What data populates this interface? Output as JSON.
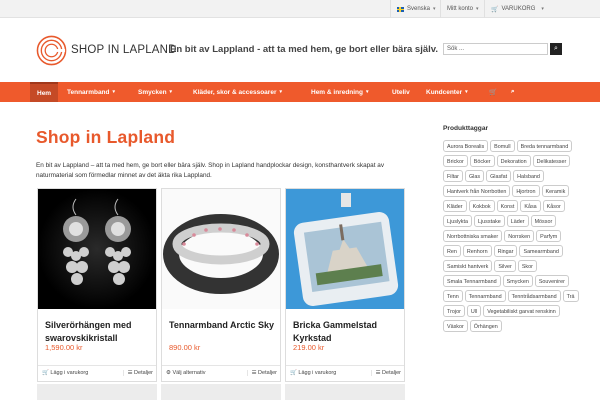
{
  "topbar": {
    "language": "Svenska",
    "account": "Mitt konto",
    "cart": "VARUKORG"
  },
  "header": {
    "brand": "SHOP IN LAPLAND",
    "tagline": "En bit av Lappland - att ta med hem, ge bort eller bära själv.",
    "search_placeholder": "Sök ..."
  },
  "nav": {
    "items": [
      "Hem",
      "Tennarmband",
      "Smycken",
      "Kläder, skor & accessoarer",
      "Hem & inredning",
      "Uteliv",
      "Kundcenter"
    ]
  },
  "main": {
    "title": "Shop in Lapland",
    "intro": "En bit av Lappland – att ta med hem, ge bort eller bära själv. Shop in Lapland handplockar design, konsthantverk skapat av naturmaterial som förmedlar minnet av det äkta rika Lappland."
  },
  "products": [
    {
      "name": "Silverörhängen med swarovskikristall",
      "price": "1,590.00 kr",
      "action": "Lägg i varukorg",
      "details": "Detaljer"
    },
    {
      "name": "Tennarmband Arctic Sky",
      "price": "890.00 kr",
      "action": "Välj alternativ",
      "details": "Detaljer"
    },
    {
      "name": "Bricka Gammelstad Kyrkstad",
      "price": "219.00 kr",
      "action": "Lägg i varukorg",
      "details": "Detaljer"
    }
  ],
  "sidebar": {
    "title": "Produkttaggar",
    "tags": [
      "Aurora Borealis",
      "Bomull",
      "Breda tennarmband",
      "Brickor",
      "Böcker",
      "Dekoration",
      "Delikatesser",
      "Filtar",
      "Glas",
      "Glasfat",
      "Halsband",
      "Hantverk från Norrbotten",
      "Hjortron",
      "Keramik",
      "Kläder",
      "Kokbok",
      "Konst",
      "Kåsa",
      "Kåsor",
      "Ljuslykta",
      "Ljusstake",
      "Läder",
      "Mössor",
      "Norrbottniska smaker",
      "Norrsken",
      "Parfym",
      "Ren",
      "Renhorn",
      "Ringar",
      "Samearmband",
      "Samiskt hantverk",
      "Silver",
      "Skor",
      "Smala Tennarmband",
      "Smycken",
      "Souvenirer",
      "Tenn",
      "Tennarmband",
      "Tenntrådsarmband",
      "Trä",
      "Trojor",
      "Ull",
      "Vegetabiliskt garvat renskinn",
      "Väskor",
      "Örhängen"
    ]
  },
  "colors": {
    "accent": "#ef5a2c",
    "title": "#e8592c"
  }
}
